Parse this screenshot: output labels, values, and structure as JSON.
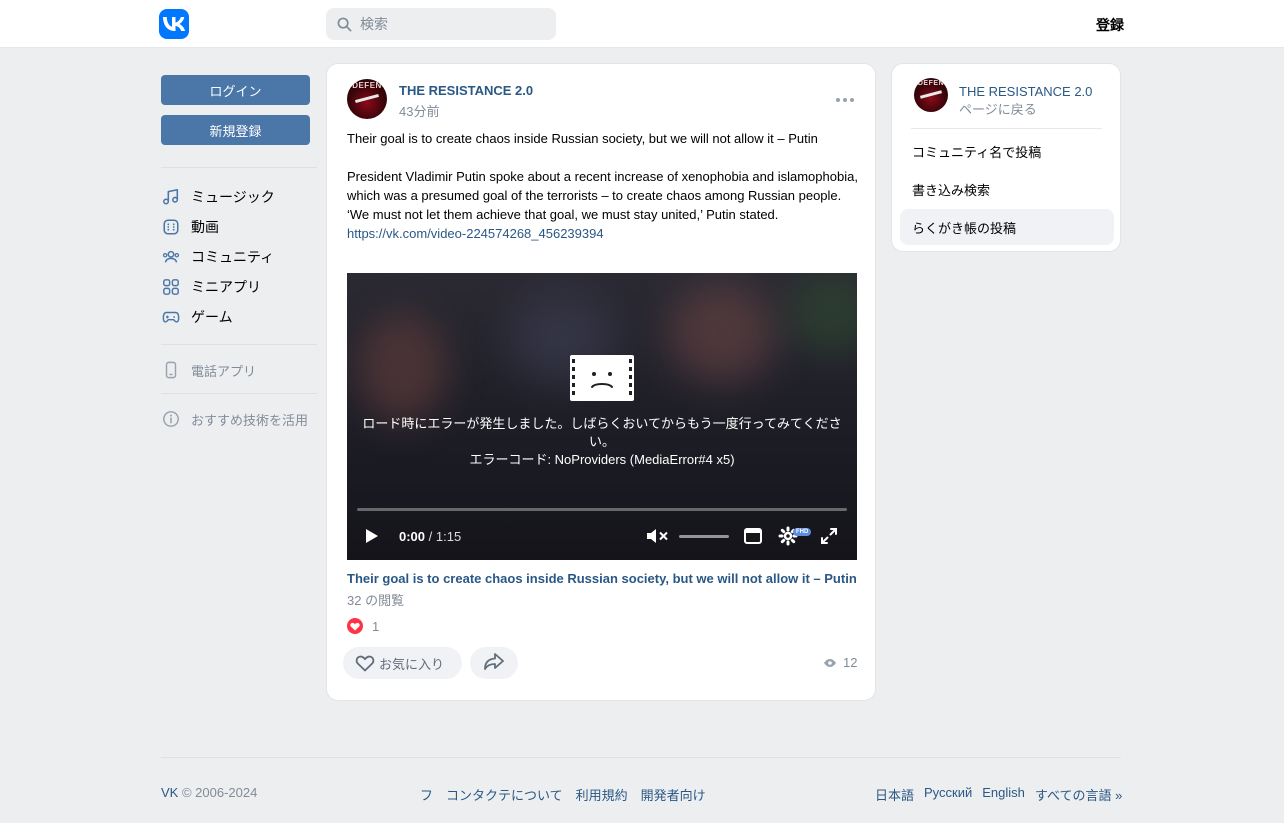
{
  "header": {
    "logo_icon": "vk-logo-icon",
    "search_placeholder": "検索",
    "register_label": "登録"
  },
  "left_nav": {
    "login_label": "ログイン",
    "signup_label": "新規登録",
    "items": [
      {
        "label": "ミュージック",
        "icon": "music-note-icon"
      },
      {
        "label": "動画",
        "icon": "video-icon"
      },
      {
        "label": "コミュニティ",
        "icon": "community-icon"
      },
      {
        "label": "ミニアプリ",
        "icon": "mini-apps-icon"
      },
      {
        "label": "ゲーム",
        "icon": "gamepad-icon"
      }
    ],
    "phone_app_label": "電話アプリ",
    "recommend_label": "おすすめ技術を活用"
  },
  "post": {
    "author": "THE RESISTANCE 2.0",
    "time": "43分前",
    "avatar_text": "DEFEN",
    "headline": "Their goal is to create chaos inside Russian society, but we will not allow it – Putin",
    "body": "President Vladimir Putin spoke about a recent increase of xenophobia and islamophobia, which was a presumed goal of the terrorists – to create chaos among Russian people. ‘We must not let them achieve that goal, we must stay united,’ Putin stated.",
    "link": "https://vk.com/video-224574268_456239394",
    "video": {
      "error_message": "ロード時にエラーが発生しました。しばらくおいてからもう一度行ってみてください。",
      "error_code": "エラーコード: NoProviders (MediaError#4 x5)",
      "current_time": "0:00",
      "separator": " / ",
      "duration": "1:15",
      "hd_badge": "FHD",
      "progress": 0
    },
    "video_title": "Their goal is to create chaos inside Russian society, but we will not allow it – Putin",
    "video_views": "32 の閲覧",
    "like_count": "1",
    "favorite_label": "お気に入り",
    "view_count": "12"
  },
  "right_panel": {
    "author": "THE RESISTANCE 2.0",
    "back_label": "ページに戻る",
    "items": [
      {
        "label": "コミュニティ名で投稿"
      },
      {
        "label": "書き込み検索"
      },
      {
        "label": "らくがき帳の投稿"
      }
    ]
  },
  "footer": {
    "brand": "VK",
    "copyright": " © 2006-2024",
    "links": [
      "フ",
      "コンタクテについて",
      "利用規約",
      "開発者向け"
    ],
    "languages": [
      "日本語",
      "Русский",
      "English",
      "すべての言語 »"
    ]
  },
  "colors": {
    "accent": "#4a76a8",
    "link": "#2a5885",
    "brand": "#0077ff",
    "like": "#ff3347",
    "muted": "#818c99"
  }
}
